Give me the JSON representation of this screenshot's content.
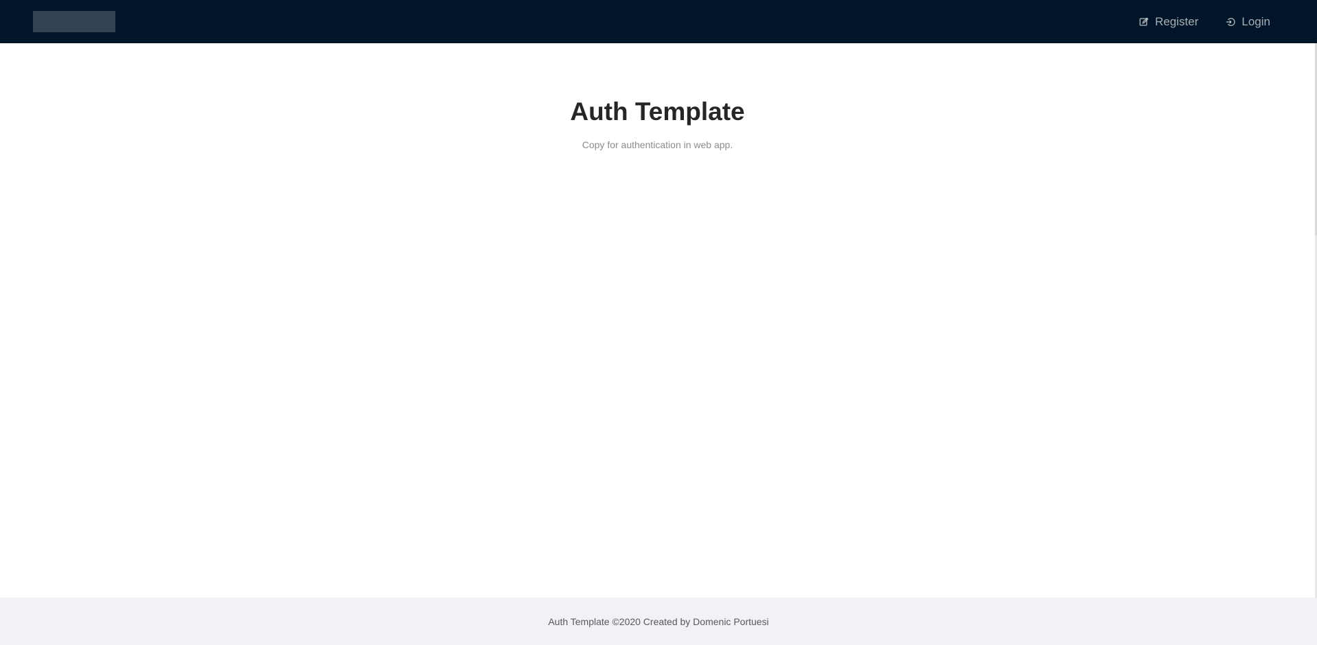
{
  "header": {
    "nav": [
      {
        "label": "Register",
        "icon": "edit-icon"
      },
      {
        "label": "Login",
        "icon": "login-icon"
      }
    ]
  },
  "main": {
    "title": "Auth Template",
    "subtitle": "Copy for authentication in web app."
  },
  "footer": {
    "text": "Auth Template ©2020 Created by Domenic Portuesi"
  },
  "colors": {
    "header_bg": "#001529",
    "footer_bg": "#f0f2f5",
    "title": "#262626",
    "subtitle": "#8c8c8c"
  }
}
